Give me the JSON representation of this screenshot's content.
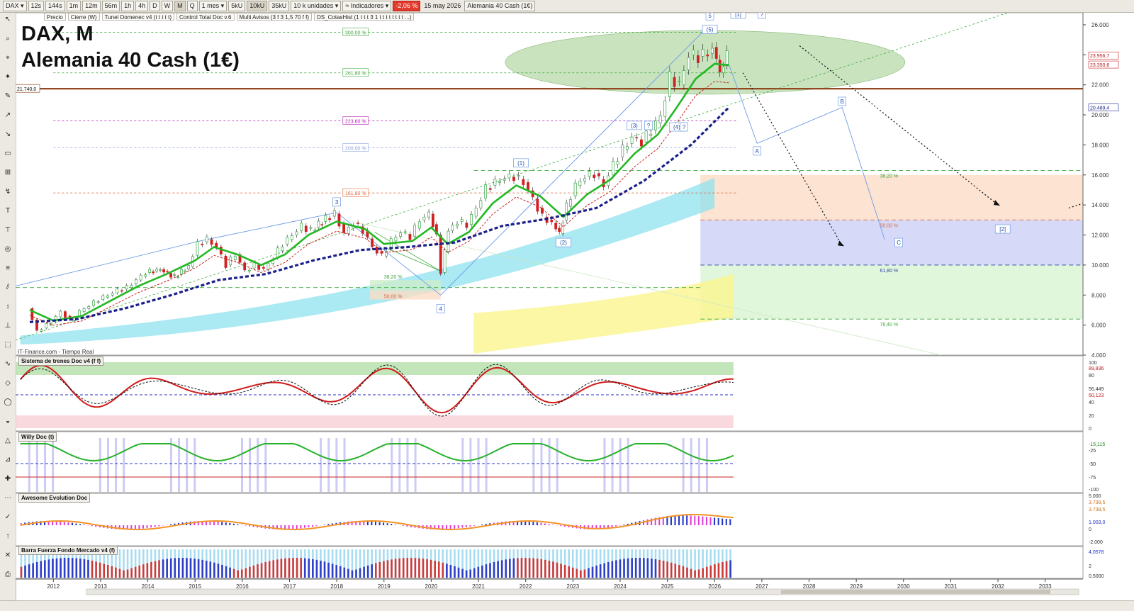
{
  "toolbar": {
    "symbol": "DAX",
    "periods": [
      "12s",
      "144s",
      "1m",
      "12m",
      "56m",
      "1h",
      "4h",
      "D",
      "W",
      "M",
      "Q"
    ],
    "active_period": "M",
    "range": "1 mes",
    "unit_buttons": [
      "5kU",
      "10kU",
      "35kU"
    ],
    "active_unit": "10kU",
    "units": "10 k unidades",
    "indicators_label": "Indicadores",
    "change_badge": "-2,06 %",
    "date": "15 may 2026",
    "instrument": "Alemania 40 Cash (1€)",
    "tags": [
      "Precio",
      "Cierre (W)",
      "Tunel Domenec v4 (t t t t t)",
      "Control Total Doc v.6",
      "Multi Avisos (3 f 3 1,5 70 f f)",
      "DS_CotasHist (1 t t t 3 1 t t t t t t t t ...)"
    ]
  },
  "chart_title": "DAX, M",
  "chart_subtitle": "Alemania 40 Cash (1€)",
  "credit": "IT-Finance.com - Tiempo Real",
  "panels": [
    "Sistema de trenes Doc v4 (f f)",
    "Willy Doc (t)",
    "Awesome Evolution Doc",
    "Barra Fuerza Fondo Mercado v4 (f)"
  ],
  "chart_data": {
    "type": "line",
    "x_label": "",
    "y_label": "",
    "x_ticks": [
      "2012",
      "2013",
      "2014",
      "2015",
      "2016",
      "2017",
      "2018",
      "2019",
      "2020",
      "2021",
      "2022",
      "2023",
      "2024",
      "2025",
      "2026",
      "2027",
      "2028",
      "2029",
      "2030",
      "2031",
      "2032",
      "2033"
    ],
    "y_ticks": [
      "4.000",
      "6.000",
      "8.000",
      "10.000",
      "12.000",
      "14.000",
      "16.000",
      "18.000",
      "20.000",
      "22.000",
      "24.000",
      "26.000"
    ],
    "ylim": [
      4000,
      26800
    ],
    "xlim": [
      2011.2,
      2033.8
    ],
    "grid": false,
    "price_points": [
      [
        2011.5,
        7100
      ],
      [
        2011.7,
        5600
      ],
      [
        2011.9,
        6000
      ],
      [
        2012.0,
        6200
      ],
      [
        2012.2,
        6900
      ],
      [
        2012.4,
        6300
      ],
      [
        2012.6,
        6900
      ],
      [
        2012.8,
        7300
      ],
      [
        2013.0,
        7700
      ],
      [
        2013.2,
        8000
      ],
      [
        2013.4,
        8300
      ],
      [
        2013.6,
        8500
      ],
      [
        2013.8,
        9000
      ],
      [
        2014.0,
        9500
      ],
      [
        2014.3,
        9700
      ],
      [
        2014.6,
        9200
      ],
      [
        2014.9,
        9900
      ],
      [
        2015.1,
        11400
      ],
      [
        2015.3,
        11700
      ],
      [
        2015.5,
        11200
      ],
      [
        2015.7,
        10000
      ],
      [
        2015.9,
        10700
      ],
      [
        2016.1,
        9600
      ],
      [
        2016.3,
        10000
      ],
      [
        2016.5,
        9700
      ],
      [
        2016.7,
        10500
      ],
      [
        2016.9,
        11400
      ],
      [
        2017.1,
        12000
      ],
      [
        2017.3,
        12600
      ],
      [
        2017.5,
        12300
      ],
      [
        2017.8,
        13100
      ],
      [
        2018.0,
        13400
      ],
      [
        2018.2,
        12100
      ],
      [
        2018.4,
        12800
      ],
      [
        2018.6,
        12300
      ],
      [
        2018.8,
        11200
      ],
      [
        2019.0,
        10600
      ],
      [
        2019.2,
        11600
      ],
      [
        2019.4,
        12200
      ],
      [
        2019.6,
        11900
      ],
      [
        2019.8,
        13000
      ],
      [
        2020.0,
        13400
      ],
      [
        2020.15,
        12000
      ],
      [
        2020.25,
        9500
      ],
      [
        2020.4,
        12300
      ],
      [
        2020.6,
        12900
      ],
      [
        2020.8,
        12700
      ],
      [
        2021.0,
        13800
      ],
      [
        2021.2,
        15100
      ],
      [
        2021.4,
        15500
      ],
      [
        2021.6,
        15800
      ],
      [
        2021.8,
        15900
      ],
      [
        2022.0,
        15500
      ],
      [
        2022.2,
        14400
      ],
      [
        2022.4,
        13200
      ],
      [
        2022.6,
        12800
      ],
      [
        2022.75,
        12100
      ],
      [
        2022.9,
        13900
      ],
      [
        2023.1,
        15300
      ],
      [
        2023.3,
        15900
      ],
      [
        2023.5,
        16100
      ],
      [
        2023.7,
        15300
      ],
      [
        2023.9,
        16700
      ],
      [
        2024.1,
        17700
      ],
      [
        2024.3,
        18500
      ],
      [
        2024.5,
        18200
      ],
      [
        2024.7,
        19000
      ],
      [
        2024.9,
        19900
      ],
      [
        2025.1,
        22500
      ],
      [
        2025.3,
        22000
      ],
      [
        2025.5,
        24000
      ],
      [
        2025.7,
        23900
      ],
      [
        2025.9,
        24100
      ],
      [
        2026.0,
        24500
      ],
      [
        2026.15,
        22800
      ],
      [
        2026.3,
        23956
      ]
    ],
    "ema_fast": [
      [
        2011.5,
        7000
      ],
      [
        2012.0,
        6300
      ],
      [
        2012.6,
        6600
      ],
      [
        2013.2,
        7600
      ],
      [
        2013.8,
        8600
      ],
      [
        2014.4,
        9400
      ],
      [
        2015.0,
        10300
      ],
      [
        2015.4,
        11200
      ],
      [
        2015.9,
        10700
      ],
      [
        2016.4,
        10000
      ],
      [
        2016.9,
        10700
      ],
      [
        2017.4,
        12000
      ],
      [
        2018.0,
        12900
      ],
      [
        2018.6,
        12400
      ],
      [
        2019.0,
        11400
      ],
      [
        2019.6,
        11600
      ],
      [
        2020.0,
        12500
      ],
      [
        2020.35,
        11400
      ],
      [
        2020.8,
        12200
      ],
      [
        2021.3,
        14100
      ],
      [
        2021.8,
        15300
      ],
      [
        2022.3,
        14600
      ],
      [
        2022.8,
        13200
      ],
      [
        2023.3,
        14700
      ],
      [
        2023.8,
        15700
      ],
      [
        2024.3,
        17400
      ],
      [
        2024.8,
        18700
      ],
      [
        2025.2,
        20500
      ],
      [
        2025.6,
        22400
      ],
      [
        2026.0,
        23400
      ],
      [
        2026.3,
        23300
      ]
    ],
    "ema_slow": [
      [
        2011.5,
        6200
      ],
      [
        2012.5,
        6400
      ],
      [
        2013.5,
        7100
      ],
      [
        2014.5,
        8000
      ],
      [
        2015.5,
        9000
      ],
      [
        2016.5,
        9400
      ],
      [
        2017.5,
        10300
      ],
      [
        2018.5,
        11000
      ],
      [
        2019.5,
        11200
      ],
      [
        2020.5,
        11500
      ],
      [
        2021.5,
        12600
      ],
      [
        2022.5,
        13100
      ],
      [
        2023.5,
        13800
      ],
      [
        2024.5,
        15600
      ],
      [
        2025.5,
        18000
      ],
      [
        2026.3,
        20489
      ]
    ],
    "price_labels": [
      "21.740,0",
      "23.956,7",
      "23.350,6",
      "20.489,4"
    ],
    "fib_extensions": [
      "300,00 %",
      "261,80 %",
      "223,60 %",
      "200,00 %",
      "161,80 %"
    ],
    "fib_retracements": [
      "38,20 %",
      "50,00 %",
      "61,80 %",
      "76,40 %"
    ],
    "early_retracements": [
      "38,20 %",
      "50,00 %"
    ],
    "wave_labels": [
      "1",
      "2",
      "3",
      "4",
      "5",
      "(1)",
      "(2)",
      "(3)",
      "(4)",
      "(5)",
      "A",
      "B",
      "C",
      "[1]",
      "[2]",
      "?"
    ],
    "indicator_axis": {
      "trenes": [
        "100",
        "89,836",
        "80",
        "56,449",
        "50,123",
        "40",
        "20",
        "0"
      ],
      "willy": [
        "-15,115",
        "-25",
        "-50",
        "-75",
        "-100"
      ],
      "awesome": [
        "5.000",
        "3.739,5",
        "3.739,5",
        "1.003,0",
        "0",
        "-2.000"
      ],
      "barra": [
        "4,0578",
        "2",
        "0,5000"
      ]
    },
    "colors": {
      "price_up": "#1f9e2e",
      "price_down": "#d21f1f",
      "ema_fast": "#22b822",
      "ema_slow": "#1a1f8a",
      "support": "#8b3a10",
      "zone_green": "#9ccc8a",
      "wave_line": "#6f9be6"
    }
  }
}
